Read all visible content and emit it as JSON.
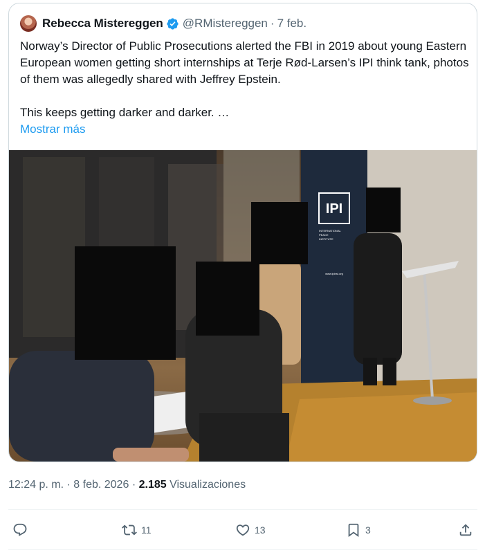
{
  "quoted_tweet": {
    "author_name": "Rebecca Mistereggen",
    "handle": "@RMistereggen",
    "separator": "·",
    "date": "7 feb.",
    "text": "Norway’s Director of Public Prosecutions alerted the FBI in 2019 about young Eastern European women getting short internships at Terje Rød-Larsen’s IPI think tank, photos of them was allegedly shared with Jeffrey Epstein.\n\nThis keeps getting darker and darker. …",
    "show_more": "Mostrar más",
    "image": {
      "banner_logo": "IPI",
      "banner_caption_lines": [
        "INTERNATIONAL",
        "PEACE",
        "INSTITUTE"
      ],
      "banner_url": "www.ipinst.org"
    }
  },
  "meta": {
    "time": "12:24 p. m.",
    "separator1": "·",
    "date": "8 feb. 2026",
    "separator2": "·",
    "views_count": "2.185",
    "views_label": "Visualizaciones"
  },
  "actions": {
    "reply_icon": "reply-icon",
    "retweet_icon": "retweet-icon",
    "retweet_count": "11",
    "like_icon": "heart-icon",
    "like_count": "13",
    "bookmark_icon": "bookmark-icon",
    "bookmark_count": "3",
    "share_icon": "share-icon"
  },
  "colors": {
    "accent": "#1d9bf0",
    "secondary_text": "#536471",
    "border": "#cfd9de",
    "verified": "#1d9bf0"
  }
}
